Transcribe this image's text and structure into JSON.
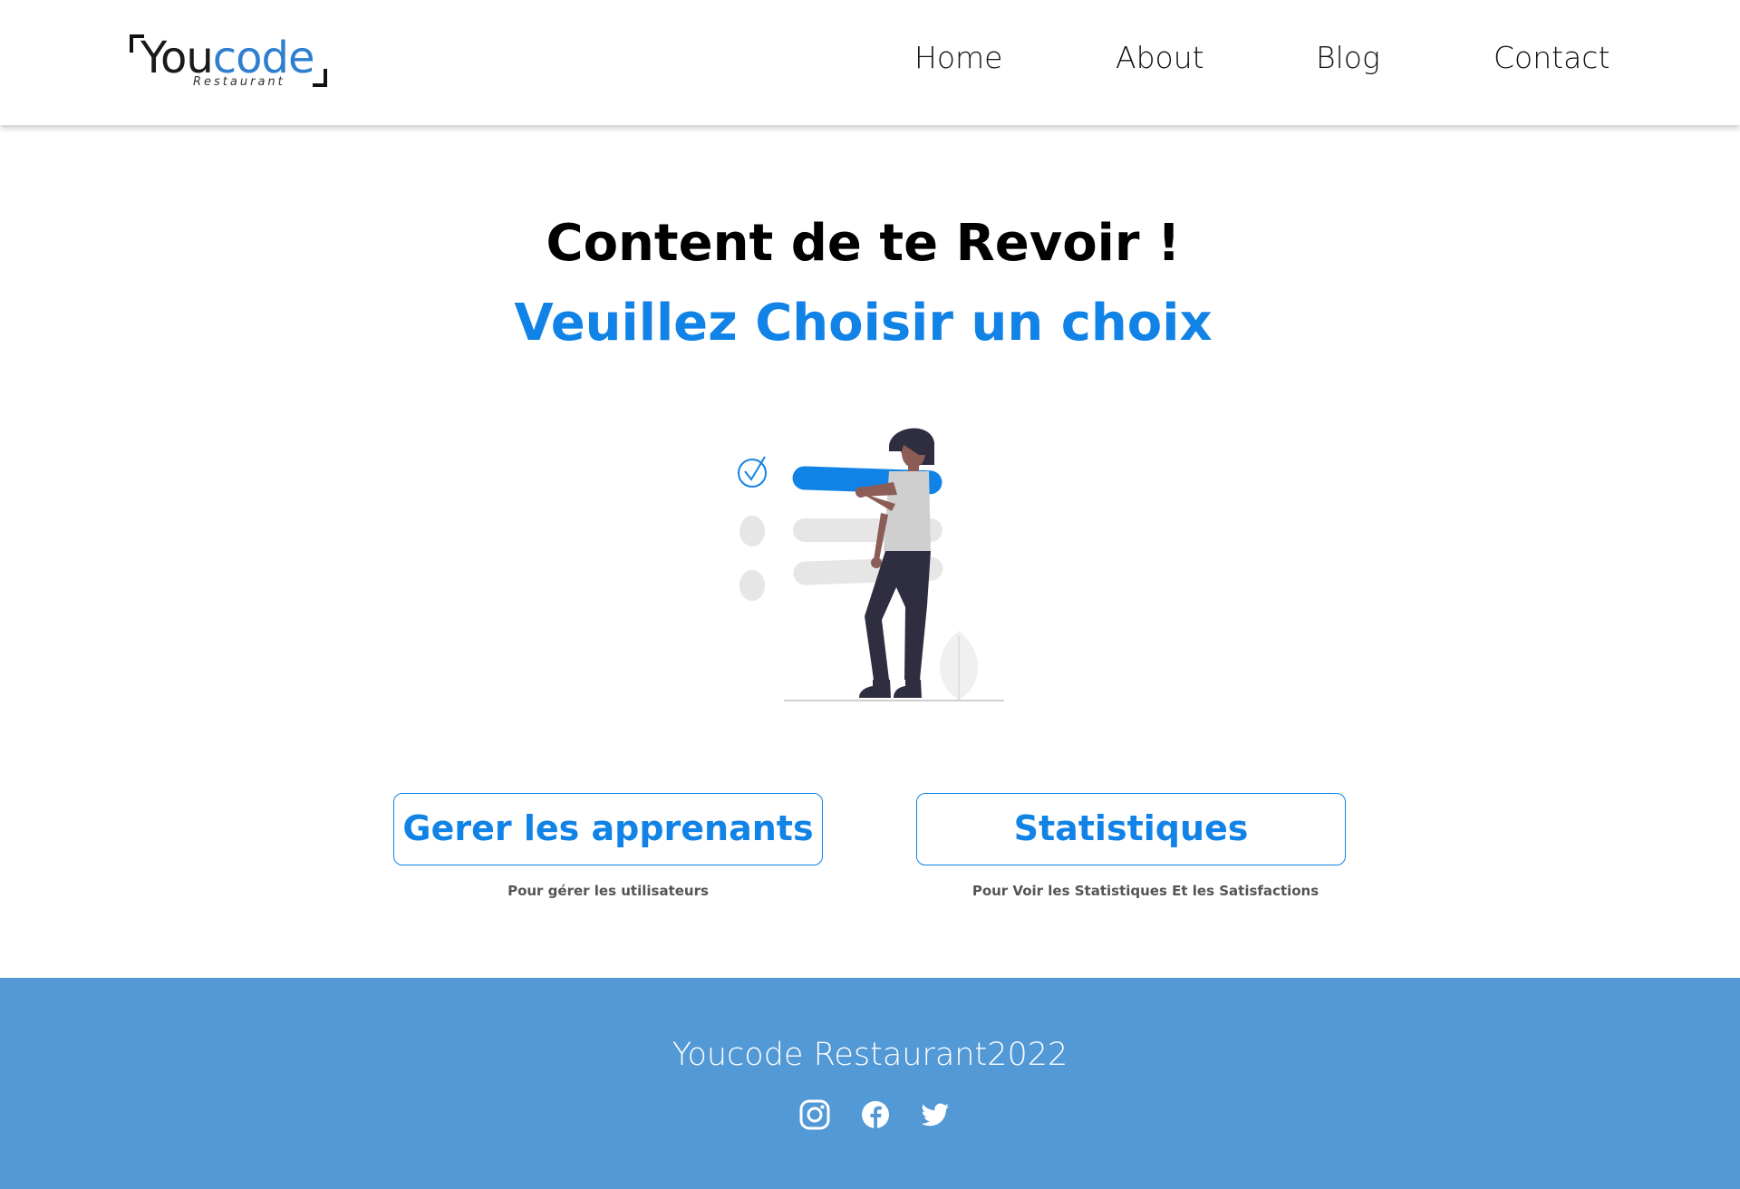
{
  "header": {
    "logo": {
      "word_part1": "You",
      "word_part2": "code",
      "subtitle": "Restaurant"
    },
    "nav": [
      {
        "label": "Home"
      },
      {
        "label": "About"
      },
      {
        "label": "Blog"
      },
      {
        "label": "Contact"
      }
    ]
  },
  "hero": {
    "title": "Content de te Revoir !",
    "subtitle": "Veuillez Choisir un choix",
    "illustration_icon": "checklist-woman-illustration"
  },
  "choices": [
    {
      "label": "Gerer les apprenants",
      "description": "Pour gérer les utilisateurs"
    },
    {
      "label": "Statistiques",
      "description": "Pour Voir les Statistiques Et les Satisfactions"
    }
  ],
  "footer": {
    "text": "Youcode Restaurant2022",
    "social": [
      "instagram-icon",
      "facebook-icon",
      "twitter-icon"
    ]
  },
  "colors": {
    "accent": "#1283e6",
    "footer_bg": "#5299d6",
    "logo_blue": "#2f7fd0"
  }
}
